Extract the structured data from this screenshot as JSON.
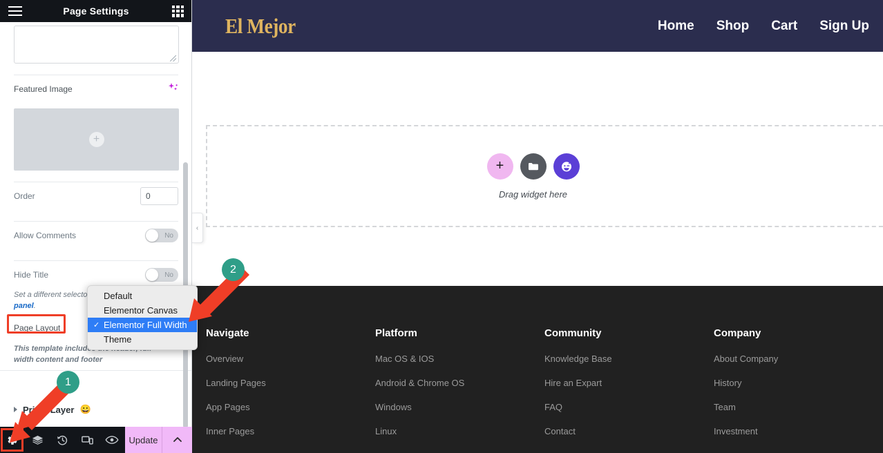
{
  "panel": {
    "title": "Page Settings",
    "hamburger_icon": "hamburger-menu-icon",
    "grid_icon": "apps-grid-icon",
    "excerpt": {
      "value": "",
      "placeholder": ""
    },
    "featured_image": {
      "label": "Featured Image",
      "ai_icon": "ai-sparkle-icon",
      "add_icon": "plus-circle-icon"
    },
    "order": {
      "label": "Order",
      "value": "0"
    },
    "allow_comments": {
      "label": "Allow Comments",
      "state": "No"
    },
    "hide_title": {
      "label": "Hide Title",
      "state": "No"
    },
    "helper_text": "Set a different selector",
    "helper_link": "panel",
    "helper_tail": ".",
    "page_layout_label": "Page Layout",
    "template_note": "This template includes the header, full-width content and footer",
    "layer_row": {
      "label": "Prime Layer",
      "emoji": "😀",
      "caret_icon": "caret-right-icon"
    }
  },
  "dropdown": {
    "options": [
      {
        "label": "Default",
        "selected": false
      },
      {
        "label": "Elementor Canvas",
        "selected": false
      },
      {
        "label": "Elementor Full Width",
        "selected": true
      },
      {
        "label": "Theme",
        "selected": false
      }
    ],
    "check_glyph": "✓"
  },
  "bottom_bar": {
    "icons": [
      {
        "name": "settings-gear-icon",
        "glyph": "⚙"
      },
      {
        "name": "navigator-layers-icon",
        "glyph": "≣"
      },
      {
        "name": "history-clock-icon",
        "glyph": "↺"
      },
      {
        "name": "responsive-devices-icon",
        "glyph": "▭"
      },
      {
        "name": "preview-eye-icon",
        "glyph": "◉"
      }
    ],
    "update_label": "Update",
    "caret_glyph": "⌃"
  },
  "canvas": {
    "site_header": {
      "logo": "El Mejor",
      "nav": [
        "Home",
        "Shop",
        "Cart",
        "Sign Up"
      ]
    },
    "dropzone": {
      "label": "Drag widget here",
      "buttons": [
        {
          "name": "add-widget-button",
          "glyph": "+"
        },
        {
          "name": "add-template-folder-button",
          "glyph": "folder"
        },
        {
          "name": "ai-assistant-button",
          "glyph": "face"
        }
      ]
    },
    "collapse_tab": {
      "icon": "chevron-left-icon",
      "glyph": "‹"
    },
    "footer": {
      "columns": [
        {
          "title": "Navigate",
          "links": [
            "Overview",
            "Landing Pages",
            "App Pages",
            "Inner Pages"
          ]
        },
        {
          "title": "Platform",
          "links": [
            "Mac OS & IOS",
            "Android & Chrome OS",
            "Windows",
            "Linux"
          ]
        },
        {
          "title": "Community",
          "links": [
            "Knowledge Base",
            "Hire an Expart",
            "FAQ",
            "Contact"
          ]
        },
        {
          "title": "Company",
          "links": [
            "About Company",
            "History",
            "Team",
            "Investment"
          ]
        }
      ]
    }
  },
  "annotations": {
    "badges": [
      {
        "label": "1"
      },
      {
        "label": "2"
      }
    ],
    "highlight_color": "#ef3e27",
    "badge_color": "#2f9e88"
  }
}
